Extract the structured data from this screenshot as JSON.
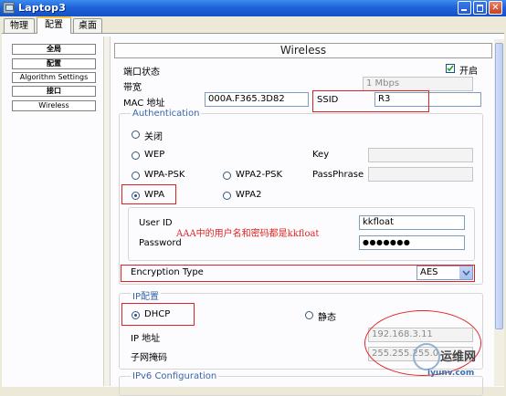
{
  "window": {
    "title": "Laptop3"
  },
  "tabs": [
    "物理",
    "配置",
    "桌面"
  ],
  "nav": {
    "global": "全局",
    "settings": "配置",
    "algorithm": "Algorithm Settings",
    "interface": "接口",
    "wireless": "Wireless"
  },
  "panel": {
    "heading": "Wireless",
    "port_status_label": "端口状态",
    "on_label": "开启",
    "bandwidth_label": "带宽",
    "bandwidth_value": "1 Mbps",
    "mac_label": "MAC 地址",
    "mac_value": "000A.F365.3D82",
    "ssid_label": "SSID",
    "ssid_value": "R3"
  },
  "auth": {
    "title": "Authentication",
    "off": "关闭",
    "wep": "WEP",
    "wpa_psk": "WPA-PSK",
    "wpa2_psk": "WPA2-PSK",
    "wpa": "WPA",
    "wpa2": "WPA2",
    "key_label": "Key",
    "passphrase_label": "PassPhrase",
    "user_id_label": "User ID",
    "user_id_value": "kkfloat",
    "password_label": "Password",
    "password_value": "●●●●●●●",
    "annotation": "AAA中的用户名和密码都是kkfloat",
    "encryption_label": "Encryption Type",
    "encryption_value": "AES"
  },
  "ip": {
    "title": "IP配置",
    "dhcp": "DHCP",
    "static": "静态",
    "ip_label": "IP 地址",
    "ip_value": "192.168.3.11",
    "mask_label": "子网掩码",
    "mask_value": "255.255.255.0"
  },
  "ipv6": {
    "title": "IPv6 Configuration"
  },
  "watermark": {
    "brand": "运维网",
    "domain": "iyunv.com"
  },
  "colors": {
    "accent_red": "#e22222",
    "section_blue": "#3965a8",
    "titlebar_blue": "#1f63d8"
  }
}
